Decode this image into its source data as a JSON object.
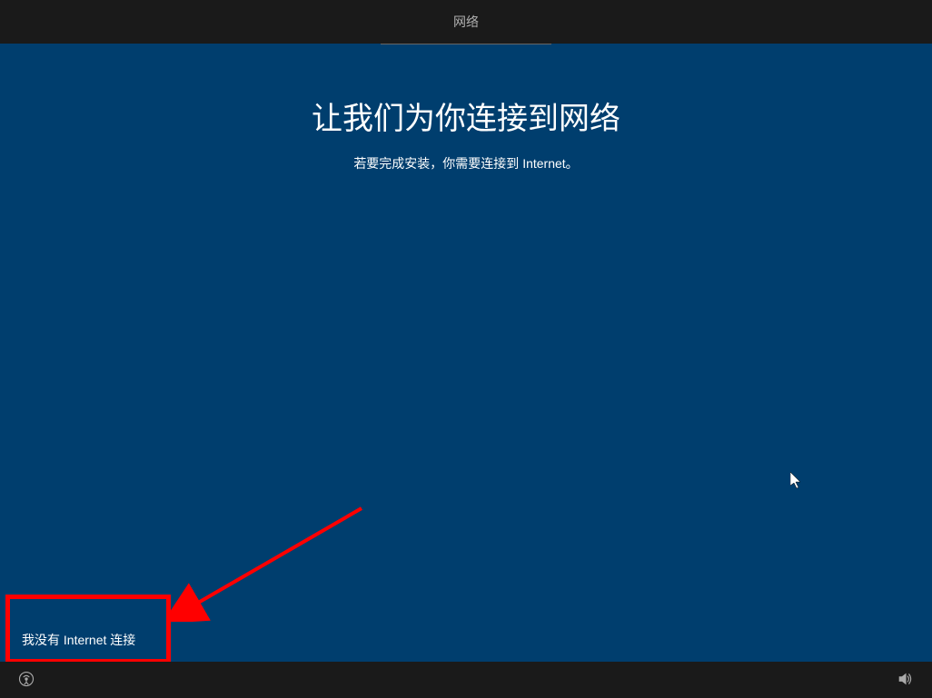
{
  "header": {
    "tab_label": "网络"
  },
  "content": {
    "title": "让我们为你连接到网络",
    "subtitle": "若要完成安装，你需要连接到 Internet。"
  },
  "buttons": {
    "no_internet": "我没有 Internet 连接"
  },
  "annotation": {
    "highlight_color": "#ff0000",
    "arrow_color": "#ff0000"
  }
}
